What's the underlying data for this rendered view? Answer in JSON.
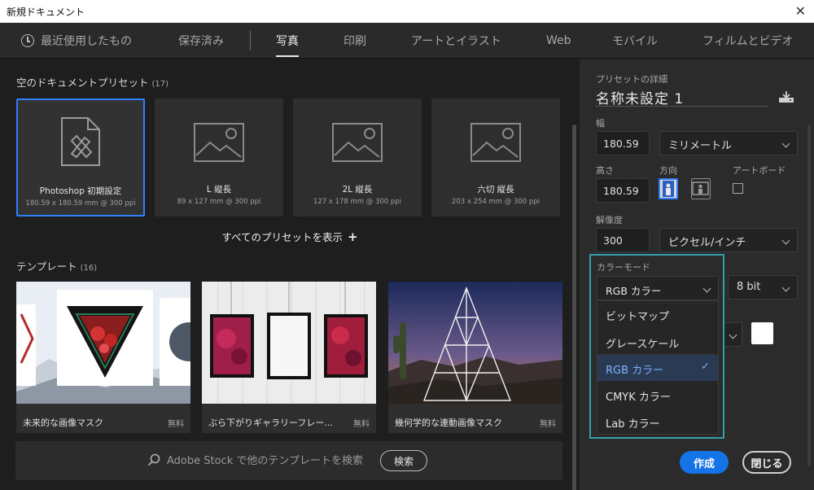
{
  "window": {
    "title": "新規ドキュメント",
    "close_glyph": "✕"
  },
  "tabs": [
    {
      "label": "最近使用したもの"
    },
    {
      "label": "保存済み"
    },
    {
      "label": "写真",
      "active": true
    },
    {
      "label": "印刷"
    },
    {
      "label": "アートとイラスト"
    },
    {
      "label": "Web"
    },
    {
      "label": "モバイル"
    },
    {
      "label": "フィルムとビデオ"
    }
  ],
  "presets_section": {
    "title": "空のドキュメントプリセット",
    "count": "(17)"
  },
  "presets": [
    {
      "name": "Photoshop 初期設定",
      "size": "180.59 x 180.59 mm @ 300 ppi",
      "selected": true
    },
    {
      "name": "L 縦長",
      "size": "89 x 127 mm @ 300 ppi"
    },
    {
      "name": "2L 縦長",
      "size": "127 x 178 mm @ 300 ppi"
    },
    {
      "name": "六切 縦長",
      "size": "203 x 254 mm @ 300 ppi"
    }
  ],
  "show_all": {
    "label": "すべてのプリセットを表示",
    "plus": "+"
  },
  "templates_section": {
    "title": "テンプレート",
    "count": "(16)"
  },
  "templates": [
    {
      "name": "未来的な画像マスク",
      "price": "無料"
    },
    {
      "name": "ぶら下がりギャラリーフレー...",
      "price": "無料"
    },
    {
      "name": "幾何学的な連動画像マスク",
      "price": "無料"
    }
  ],
  "stock_search": {
    "placeholder": "Adobe Stock で他のテンプレートを検索",
    "button": "検索"
  },
  "details": {
    "section_label": "プリセットの詳細",
    "doc_name": "名称未設定 1",
    "width_label": "幅",
    "width_value": "180.59",
    "width_unit": "ミリメートル",
    "height_label": "高さ",
    "height_value": "180.59",
    "orientation_label": "方向",
    "artboard_label": "アートボード",
    "resolution_label": "解像度",
    "resolution_value": "300",
    "resolution_unit": "ピクセル/インチ",
    "color_mode_label": "カラーモード",
    "color_mode_value": "RGB カラー",
    "bit_depth": "8 bit",
    "background_color": "#ffffff"
  },
  "color_mode_options": [
    {
      "label": "ビットマップ"
    },
    {
      "label": "グレースケール"
    },
    {
      "label": "RGB カラー",
      "selected": true
    },
    {
      "label": "CMYK カラー"
    },
    {
      "label": "Lab カラー"
    }
  ],
  "check_glyph": "✓",
  "actions": {
    "create": "作成",
    "close": "閉じる"
  },
  "colors": {
    "accent": "#2f7fff",
    "create_button": "#1473e6",
    "highlight_box": "#35a0ad"
  }
}
